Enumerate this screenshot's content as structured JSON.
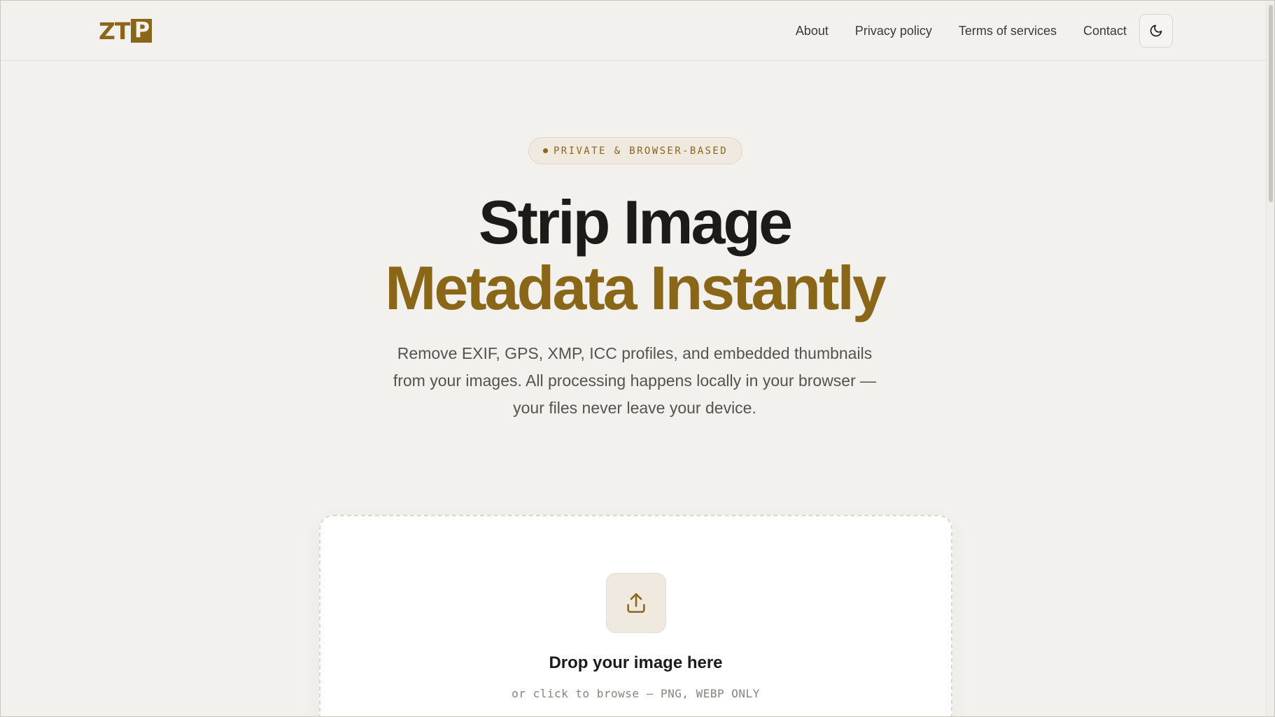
{
  "header": {
    "logo_text": "ZT",
    "logo_box_letter": "P",
    "nav": [
      {
        "label": "About"
      },
      {
        "label": "Privacy policy"
      },
      {
        "label": "Terms of services"
      },
      {
        "label": "Contact"
      }
    ],
    "theme_toggle_icon": "moon-icon"
  },
  "hero": {
    "badge": "PRIVATE & BROWSER-BASED",
    "headline_line1": "Strip Image",
    "headline_line2": "Metadata Instantly",
    "subtext": "Remove EXIF, GPS, XMP, ICC profiles, and embedded thumbnails from your images. All processing happens locally in your browser — your files never leave your device."
  },
  "dropzone": {
    "icon": "upload-icon",
    "title": "Drop your image here",
    "hint": "or click to browse — PNG, WEBP ONLY"
  },
  "colors": {
    "background": "#f3f1ed",
    "accent": "#8a6618",
    "text_dark": "#1c1b19",
    "text_muted": "#56534d"
  }
}
